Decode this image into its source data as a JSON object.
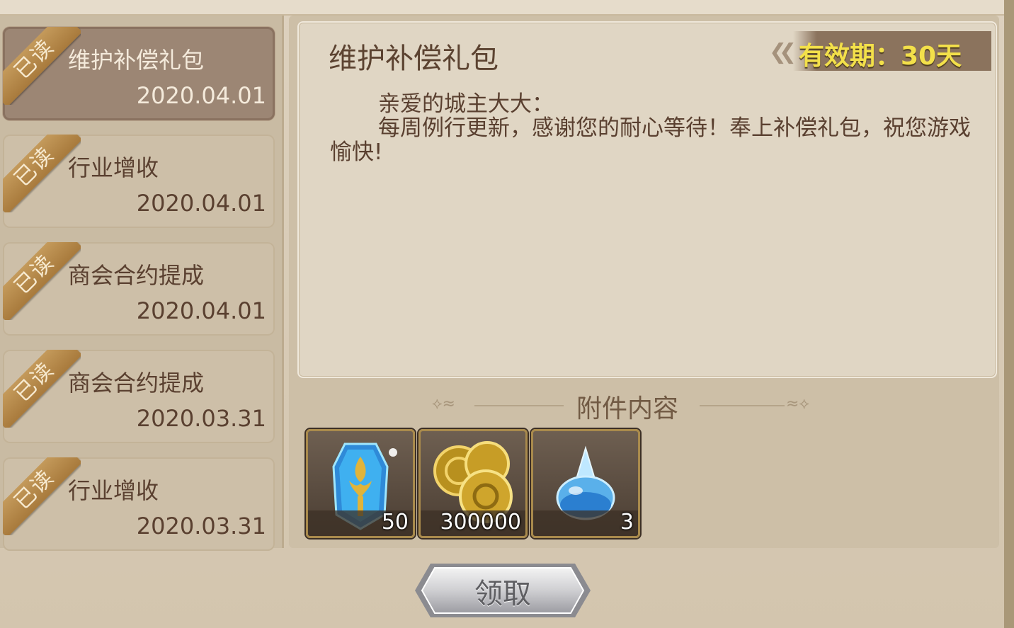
{
  "read_badge": "已读",
  "mails": [
    {
      "title": "维护补偿礼包",
      "date": "2020.04.01",
      "selected": true
    },
    {
      "title": "行业增收",
      "date": "2020.04.01",
      "selected": false
    },
    {
      "title": "商会合约提成",
      "date": "2020.04.01",
      "selected": false
    },
    {
      "title": "商会合约提成",
      "date": "2020.03.31",
      "selected": false
    },
    {
      "title": "行业增收",
      "date": "2020.03.31",
      "selected": false
    }
  ],
  "detail": {
    "title": "维护补偿礼包",
    "validity": "有效期：30天",
    "greeting": "亲爱的城主大大：",
    "body": "每周例行更新，感谢您的耐心等待！奉上补偿礼包，祝您游戏愉快!"
  },
  "attachments": {
    "label": "附件内容",
    "items": [
      {
        "icon": "blue-crystal-emblem-icon",
        "qty": "50"
      },
      {
        "icon": "gold-coins-icon",
        "qty": "300000"
      },
      {
        "icon": "blue-potion-icon",
        "qty": "3"
      }
    ]
  },
  "claim_button": "领取",
  "colors": {
    "accent_text": "#f3e04a",
    "brown_text": "#5a4030",
    "ribbon": "#b0834a"
  }
}
